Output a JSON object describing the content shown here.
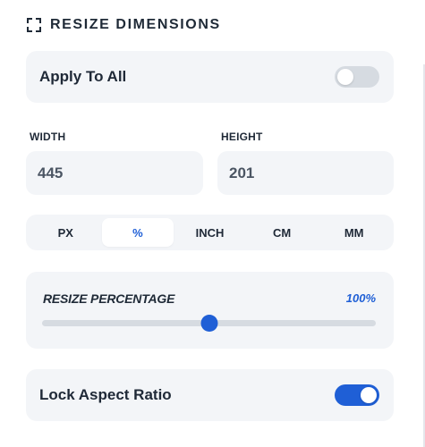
{
  "header": {
    "title": "RESIZE DIMENSIONS",
    "icon": "resize-frame-icon"
  },
  "apply_to_all": {
    "label": "Apply To All",
    "enabled": false
  },
  "dimensions": {
    "width_label": "WIDTH",
    "width_value": "445",
    "height_label": "HEIGHT",
    "height_value": "201"
  },
  "units": {
    "options": [
      "PX",
      "%",
      "INCH",
      "CM",
      "MM"
    ],
    "selected": "%"
  },
  "resize_percentage": {
    "label": "RESIZE PERCENTAGE",
    "value_text": "100%",
    "slider_fraction": 0.5
  },
  "lock_aspect_ratio": {
    "label": "Lock Aspect Ratio",
    "enabled": true
  },
  "colors": {
    "accent": "#1f5fd6",
    "card_bg": "#f3f5f8",
    "toggle_off": "#d6dbe1",
    "text_dark": "#1f2937"
  }
}
